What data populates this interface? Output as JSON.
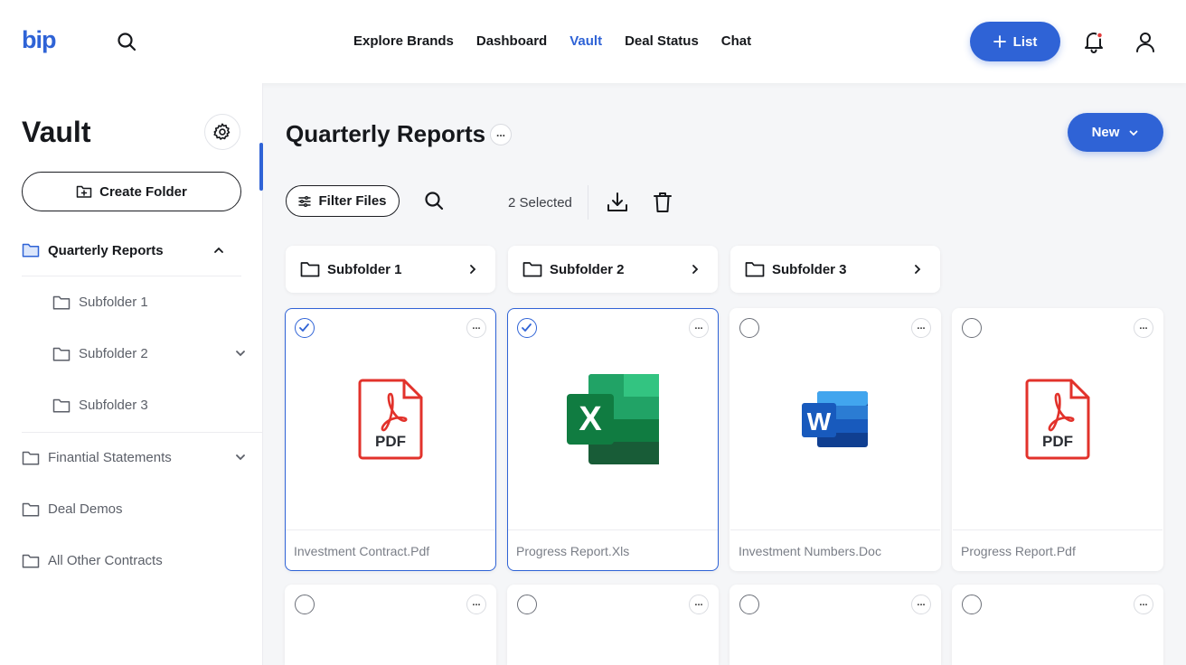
{
  "header": {
    "logo": "bip",
    "nav": [
      "Explore Brands",
      "Dashboard",
      "Vault",
      "Deal Status",
      "Chat"
    ],
    "active_nav": "Vault",
    "list_button": "List"
  },
  "sidebar": {
    "title": "Vault",
    "create_folder": "Create Folder",
    "items": [
      {
        "label": "Quarterly Reports",
        "level": 0,
        "expanded": true
      },
      {
        "label": "Subfolder 1",
        "level": 1
      },
      {
        "label": "Subfolder 2",
        "level": 1
      },
      {
        "label": "Subfolder 3",
        "level": 1
      },
      {
        "label": "Finantial Statements",
        "level": 0
      },
      {
        "label": "Deal Demos",
        "level": 0
      },
      {
        "label": "All Other Contracts",
        "level": 0
      }
    ]
  },
  "main": {
    "title": "Quarterly Reports",
    "new_button": "New",
    "filter_button": "Filter Files",
    "selected_count": "2 Selected",
    "folders": [
      "Subfolder 1",
      "Subfolder 2",
      "Subfolder 3"
    ],
    "files": [
      {
        "name": "Investment Contract.Pdf",
        "type": "pdf",
        "selected": true
      },
      {
        "name": "Progress Report.Xls",
        "type": "xls",
        "selected": true
      },
      {
        "name": "Investment Numbers.Doc",
        "type": "doc",
        "selected": false
      },
      {
        "name": "Progress Report.Pdf",
        "type": "pdf",
        "selected": false
      }
    ],
    "pdf_label": "PDF",
    "xls_letter": "X",
    "doc_letter": "W"
  },
  "colors": {
    "accent": "#2f63d6",
    "pdf_red": "#e2322b",
    "excel_green": "#1f7244",
    "word_blue": "#2b5fc7"
  }
}
